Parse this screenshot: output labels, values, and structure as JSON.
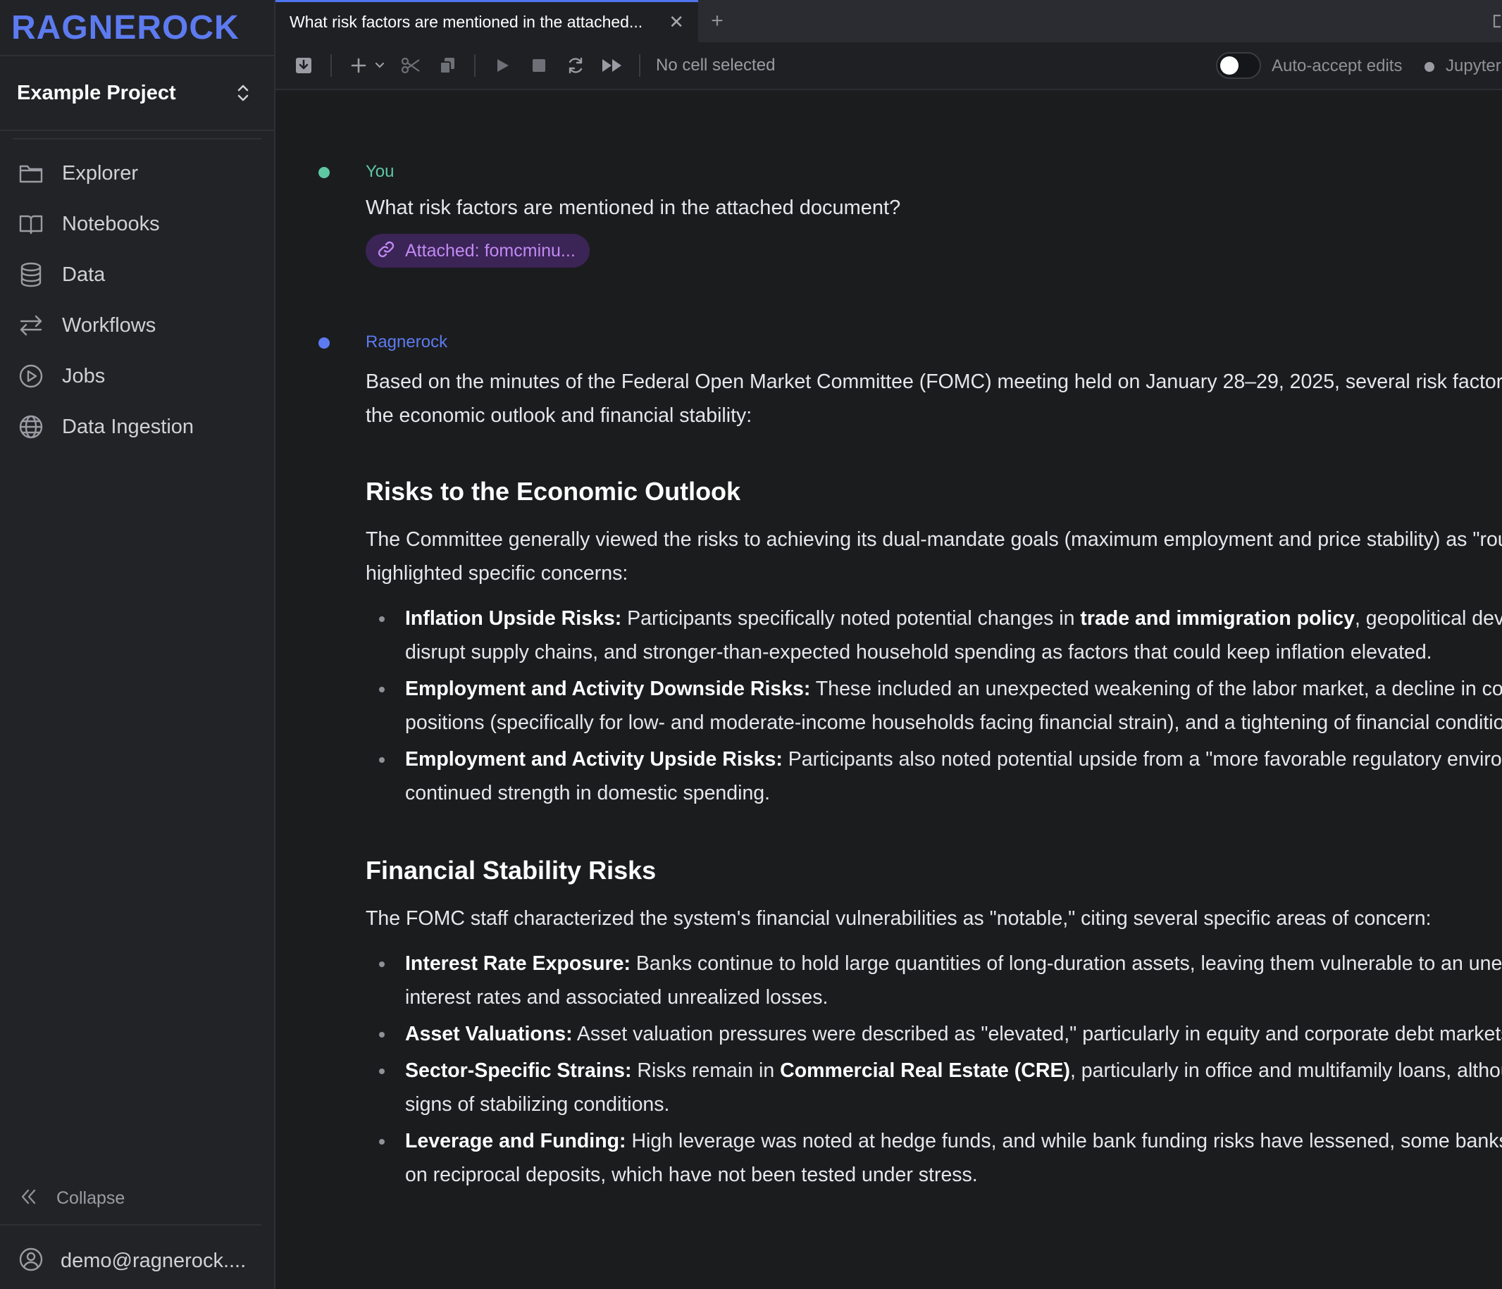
{
  "brand": {
    "logo_text": "RAGNEROCK",
    "accent": "#5d7bf0"
  },
  "sidebar": {
    "project": "Example Project",
    "items": [
      {
        "label": "Explorer",
        "icon": "folder-icon"
      },
      {
        "label": "Notebooks",
        "icon": "book-icon"
      },
      {
        "label": "Data",
        "icon": "database-icon"
      },
      {
        "label": "Workflows",
        "icon": "arrows-icon"
      },
      {
        "label": "Jobs",
        "icon": "play-circle-icon"
      },
      {
        "label": "Data Ingestion",
        "icon": "globe-icon"
      }
    ],
    "collapse_label": "Collapse",
    "user_label": "demo@ragnerock...."
  },
  "tab": {
    "title": "What risk factors are mentioned in the attached...",
    "close_glyph": "✕",
    "add_glyph": "+"
  },
  "toolbar": {
    "status": "No cell selected",
    "auto_accept_label": "Auto-accept edits",
    "auto_accept_on": false,
    "kernel_label": "Jupyter"
  },
  "chat": {
    "user": {
      "author": "You",
      "author_color": "#5ec7a3",
      "text": "What risk factors are mentioned in the attached document?",
      "attachment_label": "Attached: fomcminu..."
    },
    "assistant": {
      "author": "Ragnerock",
      "author_color": "#5d7bf0",
      "intro": "Based on the minutes of the Federal Open Market Committee (FOMC) meeting held on January 28–29, 2025, several risk factors were identified regarding the economic outlook and financial stability:",
      "section1": {
        "heading": "Risks to the Economic Outlook",
        "intro": "The Committee generally viewed the risks to achieving its dual-mandate goals (maximum employment and price stability) as \"roughly in balance,\" but highlighted specific concerns:",
        "b1_title": "Inflation Upside Risks:",
        "b1_pre": " Participants specifically noted potential changes in ",
        "b1_bold": "trade and immigration policy",
        "b1_post": ", geopolitical developments that could disrupt supply chains, and stronger-than-expected household spending as factors that could keep inflation elevated.",
        "b2_title": "Employment and Activity Downside Risks:",
        "b2_text": " These included an unexpected weakening of the labor market, a decline in consumers' financial positions (specifically for low- and moderate-income households facing financial strain), and a tightening of financial conditions.",
        "b3_title": "Employment and Activity Upside Risks:",
        "b3_text": " Participants also noted potential upside from a \"more favorable regulatory environment for businesses\" and continued strength in domestic spending."
      },
      "section2": {
        "heading": "Financial Stability Risks",
        "intro": "The FOMC staff characterized the system's financial vulnerabilities as \"notable,\" citing several specific areas of concern:",
        "b1_title": "Interest Rate Exposure:",
        "b1_text": " Banks continue to hold large quantities of long-duration assets, leaving them vulnerable to an unexpected rise in longer-term interest rates and associated unrealized losses.",
        "b2_title": "Asset Valuations:",
        "b2_text": " Asset valuation pressures were described as \"elevated,\" particularly in equity and corporate debt markets.",
        "b3_title": "Sector-Specific Strains:",
        "b3_pre": " Risks remain in ",
        "b3_bold": "Commercial Real Estate (CRE)",
        "b3_post": ", particularly in office and multifamily loans, although some participants saw signs of stabilizing conditions.",
        "b4_title": "Leverage and Funding:",
        "b4_text": " High leverage was noted at hedge funds, and while bank funding risks have lessened, some banks have increased reliance on reciprocal deposits, which have not been tested under stress."
      }
    }
  }
}
